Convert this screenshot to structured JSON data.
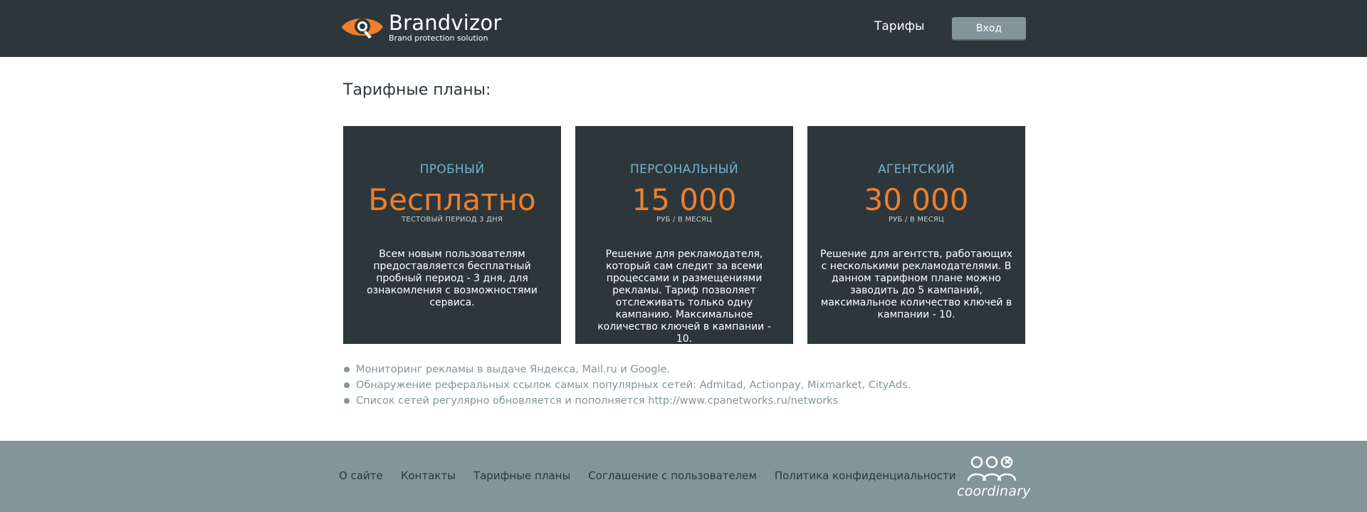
{
  "header": {
    "logo_name": "Brandvizor",
    "logo_tagline": "Brand protection solution",
    "nav_tariffs": "Тарифы",
    "login_label": "Вход"
  },
  "main": {
    "title": "Тарифные планы:",
    "plans": [
      {
        "name": "ПРОБНЫЙ",
        "price": "Бесплатно",
        "note": "ТЕСТОВЫЙ ПЕРИОД 3 ДНЯ",
        "description": "Всем новым пользователям предоставляется бесплатный пробный период - 3 дня,  для ознакомления с возможностями сервиса."
      },
      {
        "name": "ПЕРСОНАЛЬНЫЙ",
        "price": "15 000",
        "note": "РУБ / В МЕСЯЦ",
        "description": "Решение для рекламодателя, который сам следит за всеми процессами и размещениями рекламы. Тариф позволяет отслеживать только одну кампанию. Максимальное количество ключей в кампании - 10."
      },
      {
        "name": "АГЕНТСКИЙ",
        "price": "30 000",
        "note": "РУБ / В МЕСЯЦ",
        "description": "Решение для агентств, работающих с несколькими рекламодателями. В данном тарифном плане можно заводить до 5 кампаний, максимальное количество ключей в кампании - 10."
      }
    ],
    "features": [
      "Мониторинг рекламы в выдаче Яндекса, Mail.ru и Google.",
      "Обнаружение реферальных ссылок самых популярных сетей: Admitad, Actionpay, Mixmarket, CityAds.",
      "Список сетей регулярно обновляется и пополняется http://www.cpanetworks.ru/networks"
    ]
  },
  "footer": {
    "links": [
      "О сайте",
      "Контакты",
      "Тарифные планы",
      "Соглашение с пользователем",
      "Политика конфиденциальности"
    ],
    "partner_logo": "coordinary"
  },
  "colors": {
    "dark": "#2d373b",
    "accent_orange": "#ee7f2d",
    "plan_name_blue": "#6fb3c9",
    "footer_gray": "#84949b"
  },
  "icons": [
    "brandvizor-eye-logo-icon",
    "coordinary-people-logo-icon"
  ]
}
